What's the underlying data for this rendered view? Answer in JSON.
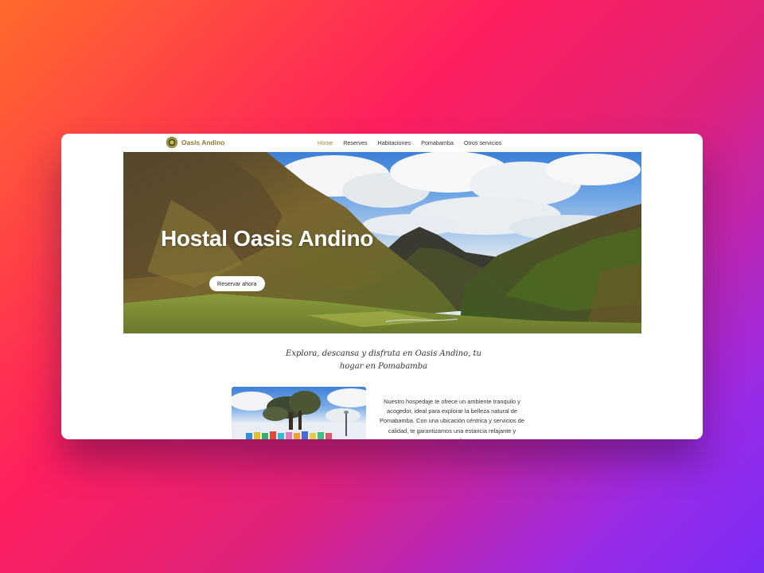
{
  "nav": {
    "brand": "Oasis Andino",
    "logo_icon": "hostel-emblem-icon",
    "items": [
      {
        "label": "Home",
        "active": true
      },
      {
        "label": "Reserves",
        "active": false
      },
      {
        "label": "Habitaciones",
        "active": false
      },
      {
        "label": "Pomabamba",
        "active": false
      },
      {
        "label": "Otros servicios",
        "active": false
      }
    ]
  },
  "hero": {
    "title": "Hostal Oasis Andino",
    "button_label": "Reservar ahora"
  },
  "tagline": "Explora, descansa y disfruta en Oasis Andino, tu hogar en Pomabamba",
  "about": {
    "text": "Nuestro hospedaje te ofrece un ambiente tranquilo y acogedor, ideal para explorar la belleza natural de Pomabamba. Con una ubicación céntrica y servicios de calidad, te garantizamos una estancia relajante y enriquecedora."
  },
  "colors": {
    "accent": "#9a8a34",
    "background_gradient_start": "#ff6a2b",
    "background_gradient_end": "#7a2cf5"
  }
}
